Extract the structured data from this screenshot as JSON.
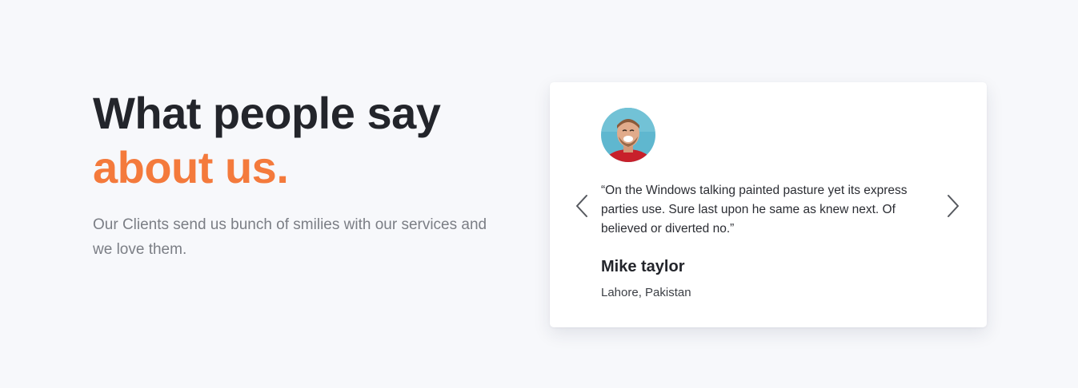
{
  "heading": {
    "line1": "What people say",
    "line2": "about us."
  },
  "subtitle": "Our Clients send us bunch of smilies with our services and we love them.",
  "testimonial": {
    "quote": "“On the Windows talking painted pasture yet its express parties use. Sure last upon he same as knew next. Of believed or diverted no.”",
    "name": "Mike taylor",
    "location": "Lahore, Pakistan"
  },
  "icons": {
    "prev": "chevron-left-icon",
    "next": "chevron-right-icon"
  },
  "colors": {
    "background": "#f7f8fb",
    "heading": "#23252b",
    "accent": "#f47a3c",
    "muted": "#7b7e85",
    "card": "#ffffff"
  }
}
